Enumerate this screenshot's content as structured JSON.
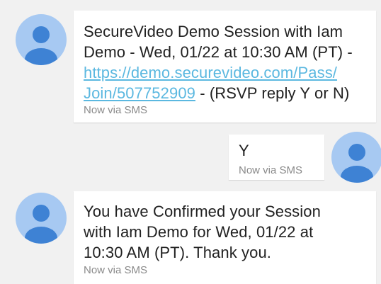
{
  "messages": [
    {
      "direction": "incoming",
      "text_line1": "SecureVideo Demo Session with Iam",
      "text_line2": "Demo - Wed, 01/22 at 10:30 AM (PT) -",
      "link_line1": "https://demo.securevideo.com/Pass/",
      "link_line2": "Join/507752909",
      "text_after_link": " - (RSVP reply Y or N)",
      "meta": "Now via SMS",
      "avatar_icon": "person-icon"
    },
    {
      "direction": "outgoing",
      "text": "Y",
      "meta": "Now via SMS",
      "avatar_icon": "person-icon"
    },
    {
      "direction": "incoming",
      "text_line1": "You have Confirmed your Session",
      "text_line2": "with Iam Demo for Wed, 01/22 at",
      "text_line3": "10:30 AM (PT). Thank you.",
      "meta": "Now via SMS",
      "avatar_icon": "person-icon"
    }
  ],
  "colors": {
    "background": "#f1f1f1",
    "bubble": "#ffffff",
    "avatar_bg": "#a7c9f2",
    "avatar_figure": "#3e82d4",
    "link": "#5bb8e0",
    "text": "#212121",
    "meta": "#8a8a8a"
  }
}
